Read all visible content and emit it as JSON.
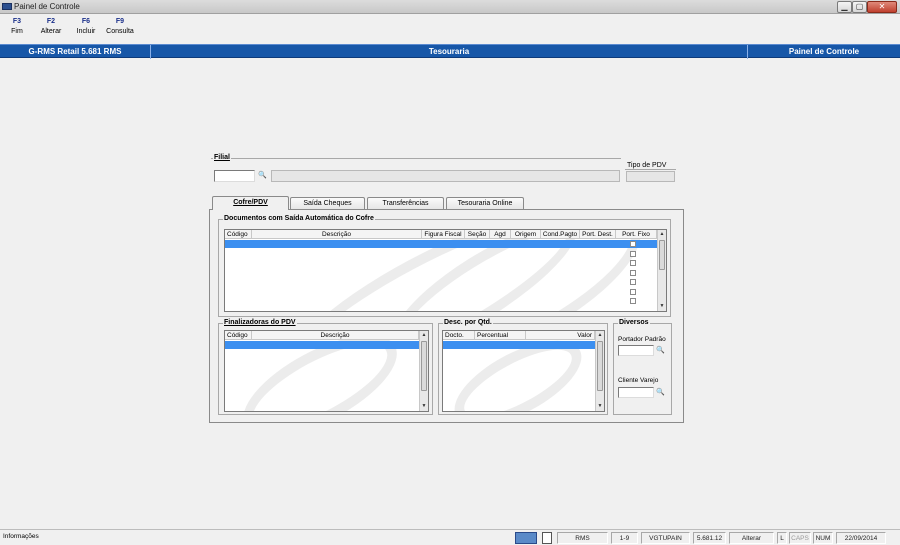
{
  "window": {
    "title": "Painel de Controle",
    "minimize": "▁",
    "maximize": "▢",
    "close": "✕"
  },
  "toolbar": {
    "buttons": [
      {
        "key": "F3",
        "label": "Fim"
      },
      {
        "key": "F2",
        "label": "Alterar"
      },
      {
        "key": "F6",
        "label": "Incluir"
      },
      {
        "key": "F9",
        "label": "Consulta"
      }
    ]
  },
  "header": {
    "app": "G-RMS Retail 5.681 RMS",
    "module": "Tesouraria",
    "panel": "Painel de Controle"
  },
  "filial": {
    "label": "Filial",
    "code": "",
    "name": "",
    "search_icon": "binoculars-icon"
  },
  "tipo_pdv": {
    "label": "Tipo de PDV",
    "value": ""
  },
  "tabs": [
    {
      "label": "Cofre/PDV",
      "active": true
    },
    {
      "label": "Saída Cheques",
      "active": false
    },
    {
      "label": "Transferências",
      "active": false
    },
    {
      "label": "Tesouraria Online",
      "active": false
    }
  ],
  "documentos": {
    "title": "Documentos com Saída Automática do Cofre",
    "columns": [
      "Código",
      "Descrição",
      "Figura Fiscal",
      "Seção",
      "Agd",
      "Origem",
      "Cond.Pagto",
      "Port. Dest.",
      "Port. Fixo"
    ],
    "rows": 7
  },
  "finalizadoras": {
    "title": "Finalizadoras do PDV",
    "columns": [
      "Código",
      "Descrição"
    ]
  },
  "desconto": {
    "title": "Desc. por Qtd.",
    "columns": [
      "Docto.",
      "Percentual",
      "Valor"
    ]
  },
  "diversos": {
    "title": "Diversos",
    "portador_label": "Portador Padrão",
    "portador_value": "",
    "cliente_label": "Cliente Varejo",
    "cliente_value": ""
  },
  "status": {
    "info": "Informações",
    "user": "RMS",
    "code": "1-9",
    "program": "VGTUPAIN",
    "version": "5.681.12",
    "mode": "Alterar",
    "l": "L",
    "caps": "CAPS",
    "num": "NUM",
    "date": "22/09/2014"
  }
}
